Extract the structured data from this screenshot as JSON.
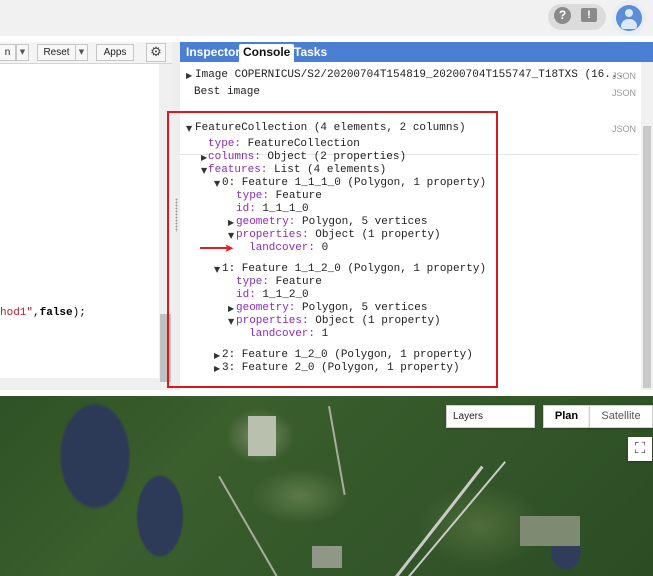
{
  "editor": {
    "toolbar": {
      "run_partial": "n",
      "reset": "Reset",
      "apps": "Apps"
    },
    "code_visible": {
      "str_part": "hod1\"",
      "rest_part": ",",
      "bool_part": "false",
      "end_part": ");"
    }
  },
  "console": {
    "tabs": [
      "Inspector",
      "Console",
      "Tasks"
    ],
    "active_tab": "Console",
    "json_label": "JSON",
    "image_line": "Image COPERNICUS/S2/20200704T154819_20200704T155747_T18TXS (16...",
    "best_image": "Best image",
    "fc": {
      "header": "FeatureCollection (4 elements, 2 columns)",
      "type_key": "type:",
      "type_val": "FeatureCollection",
      "columns_key": "columns:",
      "columns_val": "Object (2 properties)",
      "features_key": "features:",
      "features_val": "List (4 elements)",
      "items": [
        {
          "label": "0: Feature 1_1_1_0 (Polygon, 1 property)",
          "type_key": "type:",
          "type_val": "Feature",
          "id_key": "id:",
          "id_val": "1_1_1_0",
          "geom_key": "geometry:",
          "geom_val": "Polygon, 5 vertices",
          "props_key": "properties:",
          "props_val": "Object (1 property)",
          "lc_key": "landcover:",
          "lc_val": "0"
        },
        {
          "label": "1: Feature 1_1_2_0 (Polygon, 1 property)",
          "type_key": "type:",
          "type_val": "Feature",
          "id_key": "id:",
          "id_val": "1_1_2_0",
          "geom_key": "geometry:",
          "geom_val": "Polygon, 5 vertices",
          "props_key": "properties:",
          "props_val": "Object (1 property)",
          "lc_key": "landcover:",
          "lc_val": "1"
        }
      ],
      "collapsed": [
        "2: Feature 1_2_0 (Polygon, 1 property)",
        "3: Feature 2_0 (Polygon, 1 property)"
      ]
    }
  },
  "map": {
    "layers_label": "Layers",
    "map_types": [
      "Plan",
      "Satellite"
    ],
    "selected_type": "Plan"
  },
  "colors": {
    "tab_bar": "#4a7fd4",
    "highlight": "#d9191c",
    "json_key": "#8b2dbf"
  },
  "icons": [
    "help-icon",
    "feedback-icon",
    "avatar-icon",
    "gear-icon",
    "expand-triangle-icon",
    "collapse-triangle-icon",
    "fullscreen-icon",
    "red-arrow-icon"
  ]
}
